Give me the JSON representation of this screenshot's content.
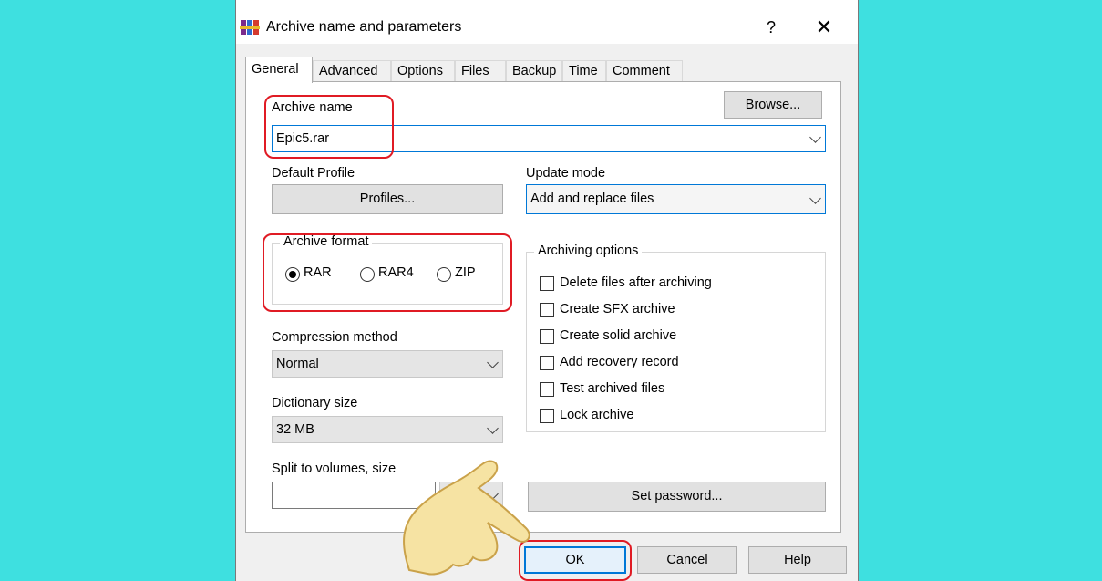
{
  "window": {
    "title": "Archive name and parameters",
    "help": "?",
    "close": "✕"
  },
  "tabs": [
    {
      "label": "General"
    },
    {
      "label": "Advanced"
    },
    {
      "label": "Options"
    },
    {
      "label": "Files"
    },
    {
      "label": "Backup"
    },
    {
      "label": "Time"
    },
    {
      "label": "Comment"
    }
  ],
  "general": {
    "archive_name_label": "Archive name",
    "archive_name_value": "Epic5.rar",
    "browse_label": "Browse...",
    "default_profile_label": "Default Profile",
    "profiles_label": "Profiles...",
    "update_mode_label": "Update mode",
    "update_mode_value": "Add and replace files",
    "archive_format": {
      "title": "Archive format",
      "options": [
        {
          "label": "RAR",
          "checked": true
        },
        {
          "label": "RAR4",
          "checked": false
        },
        {
          "label": "ZIP",
          "checked": false
        }
      ]
    },
    "archiving_options": {
      "title": "Archiving options",
      "items": [
        {
          "label": "Delete files after archiving",
          "checked": false
        },
        {
          "label": "Create SFX archive",
          "checked": false
        },
        {
          "label": "Create solid archive",
          "checked": false
        },
        {
          "label": "Add recovery record",
          "checked": false
        },
        {
          "label": "Test archived files",
          "checked": false
        },
        {
          "label": "Lock archive",
          "checked": false
        }
      ]
    },
    "compression_method_label": "Compression method",
    "compression_method_value": "Normal",
    "dictionary_size_label": "Dictionary size",
    "dictionary_size_value": "32 MB",
    "split_label": "Split to volumes, size",
    "split_value": "",
    "set_password_label": "Set password..."
  },
  "footer": {
    "ok": "OK",
    "cancel": "Cancel",
    "help": "Help"
  },
  "colors": {
    "background": "#3ee0e0",
    "highlight": "#e01b24",
    "focus": "#0078d7"
  }
}
